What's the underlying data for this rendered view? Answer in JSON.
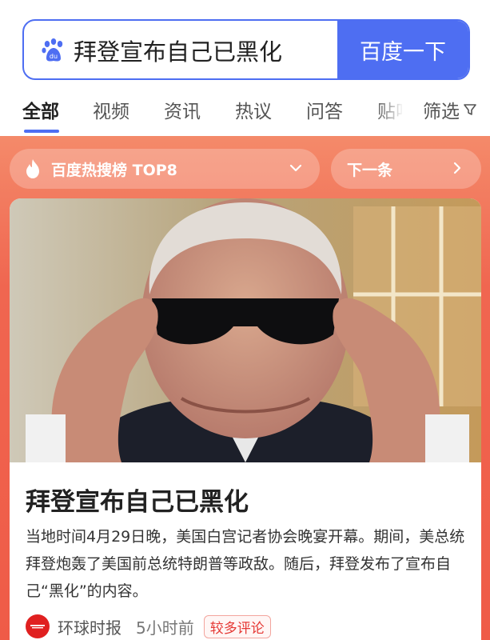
{
  "search": {
    "query": "拜登宣布自己已黑化",
    "button_label": "百度一下",
    "logo_icon": "baidu-paw-icon"
  },
  "tabs": [
    {
      "label": "全部",
      "active": true
    },
    {
      "label": "视频"
    },
    {
      "label": "资讯"
    },
    {
      "label": "热议"
    },
    {
      "label": "问答"
    },
    {
      "label": "贴吧"
    }
  ],
  "filter": {
    "label": "筛选",
    "icon": "funnel-icon"
  },
  "hot": {
    "list_label": "百度热搜榜 TOP8",
    "next_label": "下一条",
    "fire_icon": "flame-icon"
  },
  "card": {
    "title": "拜登宣布自己已黑化",
    "summary": "当地时间4月29日晚，美国白宫记者协会晚宴开幕。期间，美总统拜登炮轰了美国前总统特朗普等政敌。随后，拜登发布了宣布自己“黑化”的内容。",
    "source": "环球时报",
    "time": "5小时前",
    "badge": "较多评论"
  },
  "colors": {
    "accent": "#4e6ef2",
    "hot_gradient_top": "#f48a6a",
    "hot_gradient_bottom": "#ef5b47",
    "badge": "#e53935"
  }
}
